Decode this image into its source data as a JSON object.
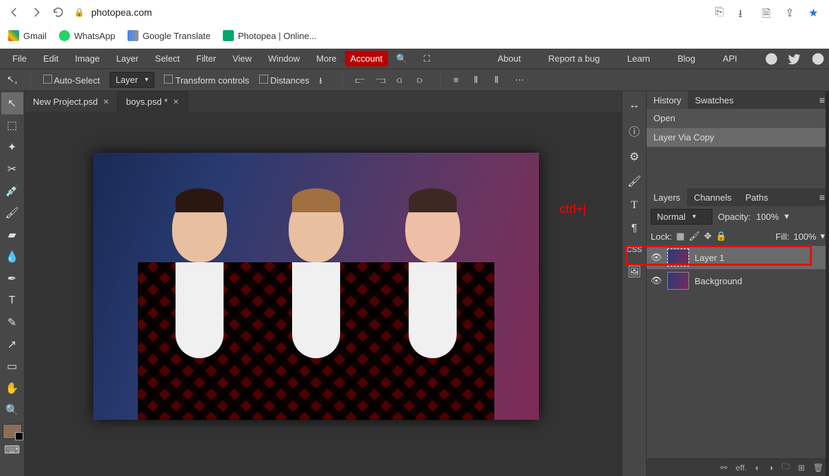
{
  "browser": {
    "url": "photopea.com",
    "bookmarks": [
      "Gmail",
      "WhatsApp",
      "Google Translate",
      "Photopea | Online..."
    ]
  },
  "menu": {
    "items": [
      "File",
      "Edit",
      "Image",
      "Layer",
      "Select",
      "Filter",
      "View",
      "Window",
      "More"
    ],
    "account": "Account",
    "right": [
      "About",
      "Report a bug",
      "Learn",
      "Blog",
      "API"
    ]
  },
  "options": {
    "auto_select": "Auto-Select",
    "layer_dd": "Layer",
    "transform": "Transform controls",
    "distances": "Distances"
  },
  "tabs": [
    {
      "label": "New Project.psd",
      "active": false
    },
    {
      "label": "boys.psd *",
      "active": true
    }
  ],
  "annotation": "ctrl+j",
  "history_panel": {
    "tabs": [
      "History",
      "Swatches"
    ],
    "items": [
      "Open",
      "Layer Via Copy"
    ]
  },
  "layers_panel": {
    "tabs": [
      "Layers",
      "Channels",
      "Paths"
    ],
    "blend": "Normal",
    "opacity_label": "Opacity:",
    "opacity_value": "100%",
    "lock_label": "Lock:",
    "fill_label": "Fill:",
    "fill_value": "100%",
    "layers": [
      {
        "name": "Layer 1",
        "selected": true
      },
      {
        "name": "Background",
        "selected": false
      }
    ]
  }
}
